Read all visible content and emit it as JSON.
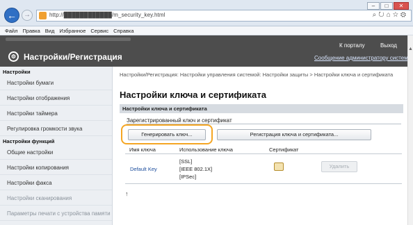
{
  "browser": {
    "url": "http://████████████/m_security_key.html",
    "menu": [
      "Файл",
      "Правка",
      "Вид",
      "Избранное",
      "Сервис",
      "Справка"
    ],
    "toolbar_icons": [
      "search-icon",
      "refresh-icon",
      "home-icon",
      "star-icon",
      "gear-icon"
    ]
  },
  "header": {
    "title": "Настройки/Регистрация",
    "portal_link": "К порталу",
    "logout_link": "Выход",
    "admin_message": "Сообщение администратору системы"
  },
  "sidebar": {
    "section1": "Настройки",
    "items1": [
      "Настройки бумаги",
      "Настройки отображения",
      "Настройки таймера",
      "Регулировка громкости звука"
    ],
    "section2": "Настройки функций",
    "items2": [
      "Общие настройки",
      "Настройки копирования",
      "Настройки факса",
      "Настройки сканирования",
      "Параметры печати с устройства памяти"
    ]
  },
  "main": {
    "breadcrumb": "Настройки/Регистрация: Настройки управления системой: Настройки защиты > Настройки ключа и сертификата",
    "title": "Настройки ключа и сертификата",
    "section_title": "Настройки ключа и сертификата",
    "subheading": "Зарегистрированный ключ и сертификат",
    "generate_button": "Генерировать ключ...",
    "register_button": "Регистрация ключа и сертификата...",
    "table": {
      "headers": [
        "Имя ключа",
        "Использование ключа",
        "Сертификат"
      ],
      "row": {
        "key_name": "Default Key",
        "key_usage": "[SSL]\n[IEEE 802.1X]\n[IPSec]",
        "delete_button": "Удалить"
      }
    },
    "top_link": "↑"
  },
  "colors": {
    "header_bg": "#4d4d4d",
    "highlight": "#f5a623",
    "link": "#1a4c9c"
  }
}
